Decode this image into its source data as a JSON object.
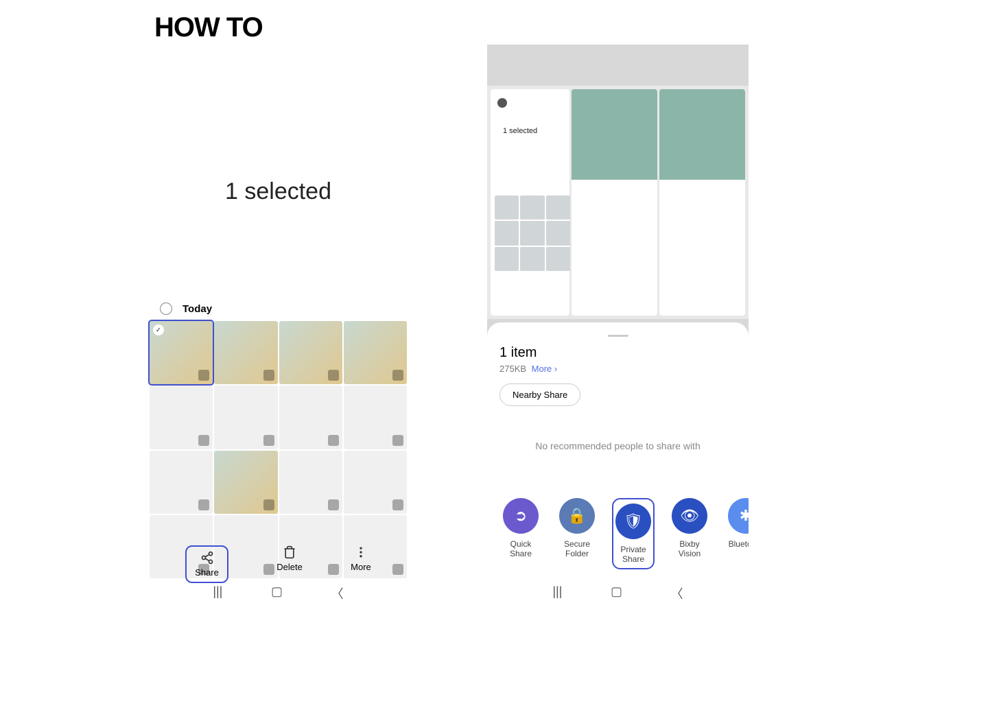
{
  "heading": "HOW TO",
  "phone1": {
    "selected_text": "1 selected",
    "today_label": "Today",
    "actions": {
      "share": "Share",
      "delete": "Delete",
      "more": "More"
    }
  },
  "phone2": {
    "selected_text": "1 selected",
    "sheet": {
      "title": "1 item",
      "size": "275KB",
      "more": "More",
      "nearby_share": "Nearby Share",
      "no_recommended": "No recommended people to share with",
      "apps": [
        {
          "label": "Quick Share"
        },
        {
          "label": "Secure Folder"
        },
        {
          "label": "Private Share"
        },
        {
          "label": "Bixby Vision"
        },
        {
          "label": "Bluetooth"
        }
      ]
    }
  }
}
